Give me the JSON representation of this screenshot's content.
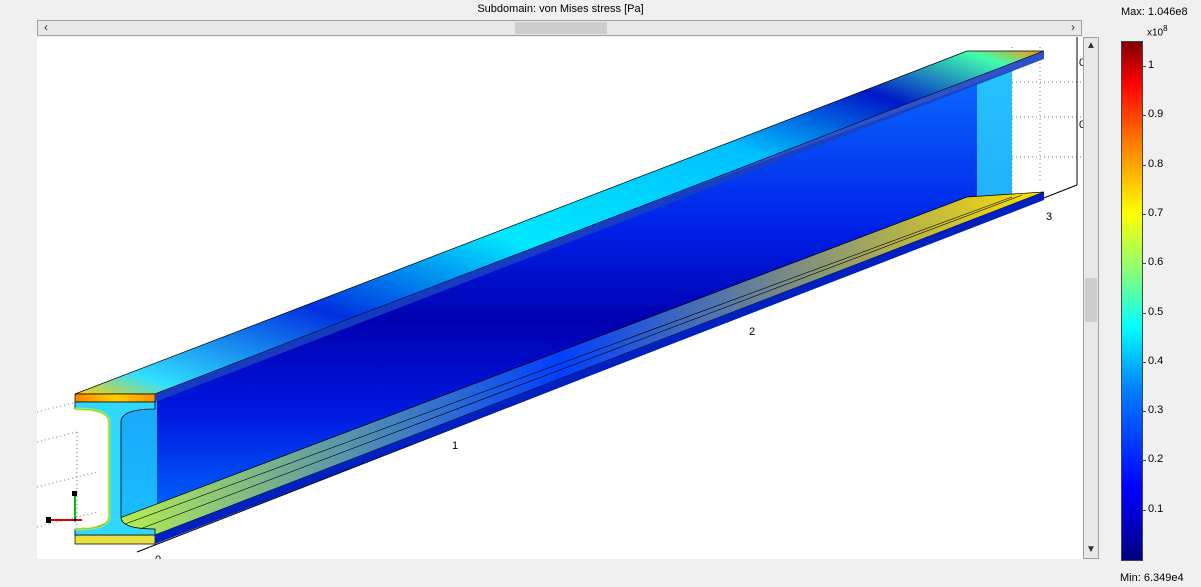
{
  "plot": {
    "title": "Subdomain: von Mises stress [Pa]",
    "axis_tick_labels": [
      "0",
      "1",
      "2",
      "3"
    ],
    "right_edge_labels": [
      "0",
      "0"
    ]
  },
  "scrollbars": {
    "left_arrow": "‹",
    "right_arrow": "›",
    "up_arrow": "▲",
    "down_arrow": "▼"
  },
  "colorbar": {
    "max_label": "Max: 1.046e8",
    "multiplier": "x10",
    "multiplier_exponent": "8",
    "min_label": "Min: 6.349e4",
    "ticks": [
      "1",
      "0.9",
      "0.8",
      "0.7",
      "0.6",
      "0.5",
      "0.4",
      "0.3",
      "0.2",
      "0.1"
    ],
    "colormap": [
      "#000080",
      "#0000ff",
      "#0080ff",
      "#00ffff",
      "#80ff80",
      "#ffff00",
      "#ff8000",
      "#ff0000",
      "#800000"
    ]
  },
  "axes_triad": {
    "x_color": "#e00000",
    "y_color": "#00c000",
    "z_color": "#000000"
  }
}
